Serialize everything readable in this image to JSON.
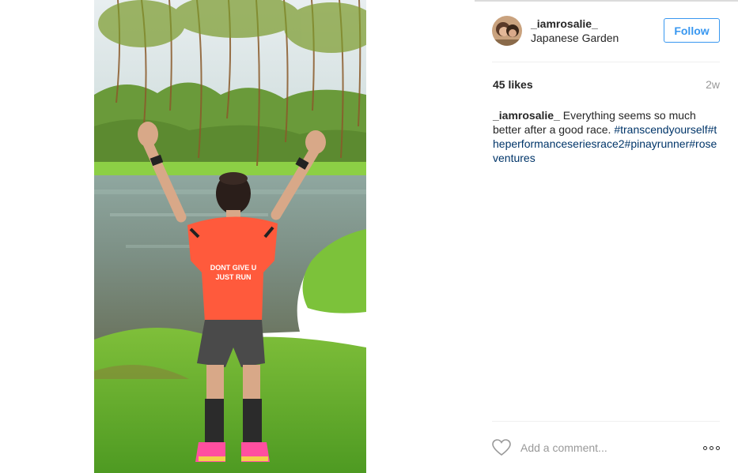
{
  "post": {
    "username": "_iamrosalie_",
    "location": "Japanese Garden",
    "follow_label": "Follow",
    "likes": "45 likes",
    "time_ago": "2w",
    "caption": {
      "username": "_iamrosalie_",
      "text": "Everything seems so much better after a good race.",
      "hashtags": [
        "#transcendyourself",
        "#theperformanceseriesrace2",
        "#pinayrunner",
        "#roseventures"
      ]
    },
    "photo_shirt_text": [
      "DONT GIVE U",
      "JUST RUN"
    ],
    "comment_placeholder": "Add a comment..."
  },
  "colors": {
    "accent": "#3897f0",
    "hashtag": "#003569",
    "muted": "#999999",
    "text": "#262626",
    "shirt": "#ff5a3c"
  },
  "icons": {
    "like": "heart-outline-icon",
    "more": "ellipsis-icon"
  }
}
